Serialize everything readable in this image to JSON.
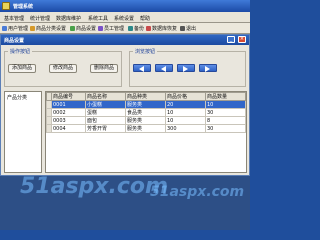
{
  "window": {
    "title": "管理系统"
  },
  "menu": [
    "基本管理",
    "统计管理",
    "数据库维护",
    "系统工具",
    "系统设置",
    "帮助"
  ],
  "toolbar": [
    {
      "label": "用户管理",
      "icon": "users-icon",
      "color": "#4a7bd6"
    },
    {
      "label": "商品分类设置",
      "icon": "category-icon",
      "color": "#d69a2a"
    },
    {
      "label": "商品设置",
      "icon": "goods-icon",
      "color": "#4aa14a"
    },
    {
      "label": "员工管理",
      "icon": "staff-icon",
      "color": "#7a52c8"
    },
    {
      "label": "备份",
      "icon": "backup-icon",
      "color": "#2d8a8a"
    },
    {
      "label": "数据库恢复",
      "icon": "restore-icon",
      "color": "#c84a4a"
    },
    {
      "label": "退出",
      "icon": "exit-icon",
      "color": "#555555"
    }
  ],
  "child": {
    "title": "商品设置",
    "ops_group": "操作按钮",
    "browse_group": "浏览按钮",
    "buttons": {
      "add": "添加商品",
      "edit": "修改商品",
      "delete": "删除商品"
    }
  },
  "tree": {
    "label": "产品分类"
  },
  "table": {
    "columns": [
      "商品编号",
      "商品名称",
      "商品种类",
      "商品价格",
      "商品数量"
    ],
    "rows": [
      [
        "0001",
        "小蛋糕",
        "服务类",
        "20",
        "10"
      ],
      [
        "0002",
        "蛋糕",
        "食品类",
        "10",
        "30"
      ],
      [
        "0003",
        "面包",
        "服务类",
        "10",
        "8"
      ],
      [
        "0004",
        "芳香开胃",
        "服务类",
        "300",
        "30"
      ]
    ]
  },
  "watermark": "51aspx.com"
}
